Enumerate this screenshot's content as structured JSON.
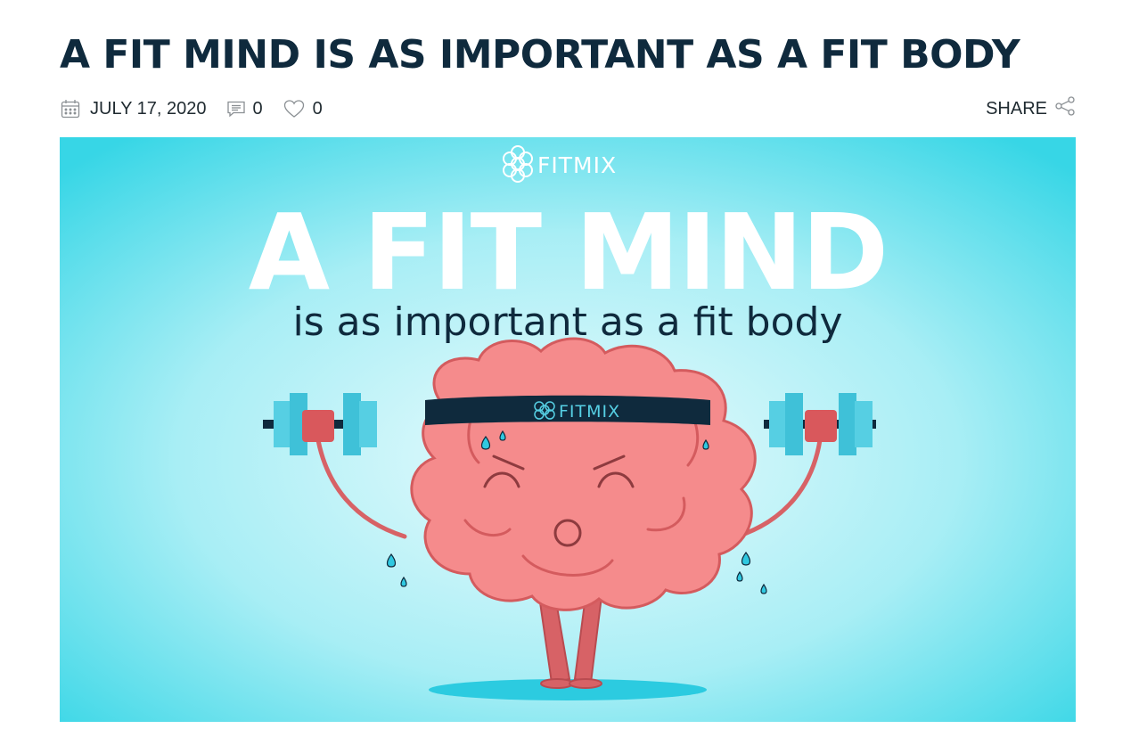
{
  "post": {
    "title": "A FIT MIND IS AS IMPORTANT AS A FIT BODY",
    "date": "JULY 17, 2020",
    "comments_count": "0",
    "likes_count": "0",
    "share_label": "SHARE"
  },
  "hero": {
    "brand": "FITMIX",
    "headline": "A FIT MIND",
    "subheadline": "is as important as a fit body",
    "headband_text": "FITMIX"
  },
  "icons": {
    "date": "calendar-icon",
    "comments": "comment-icon",
    "likes": "heart-icon",
    "share": "share-icon"
  },
  "colors": {
    "title": "#0f2a3d",
    "hero_bg_center": "#e9fbfd",
    "hero_bg_edge": "#37d6e6",
    "brain": "#f58b8c",
    "brain_outline": "#d45b5e",
    "headband": "#0f2a3d",
    "dumbbell": "#56cfe3"
  }
}
